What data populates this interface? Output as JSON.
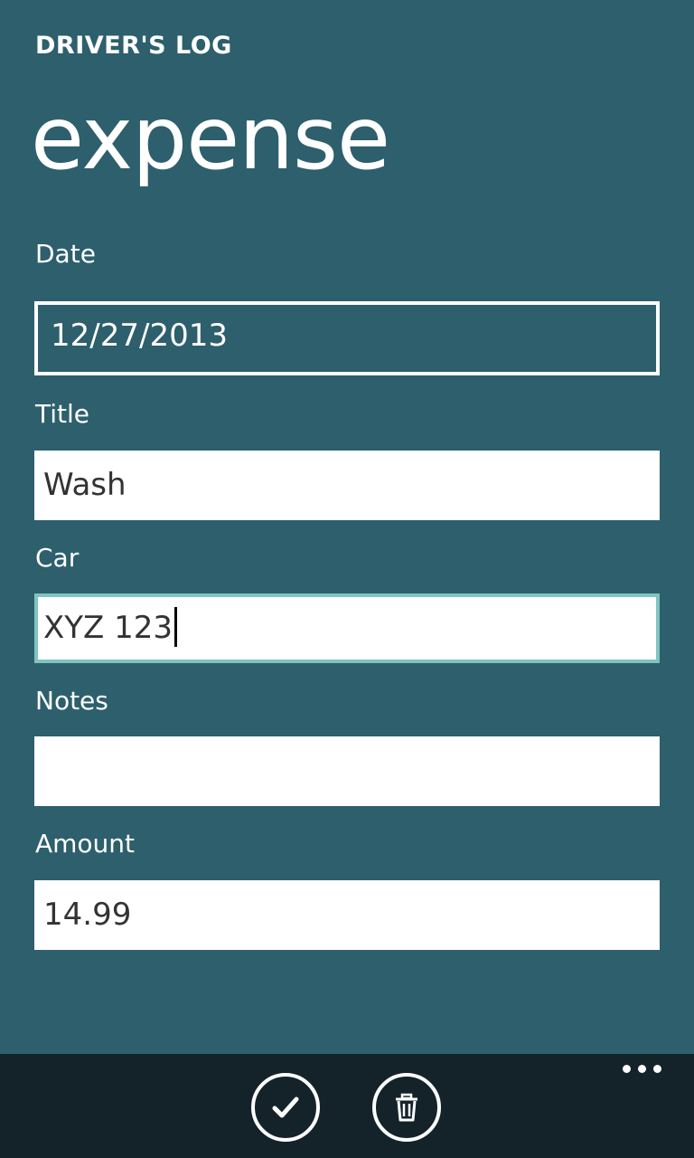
{
  "header": {
    "app_title": "DRIVER'S LOG",
    "page_title": "expense"
  },
  "form": {
    "date": {
      "label": "Date",
      "value": "12/27/2013"
    },
    "title": {
      "label": "Title",
      "value": "Wash"
    },
    "car": {
      "label": "Car",
      "value": "XYZ 123"
    },
    "notes": {
      "label": "Notes",
      "value": ""
    },
    "amount": {
      "label": "Amount",
      "value": "14.99"
    }
  },
  "appbar": {
    "buttons": [
      {
        "name": "save",
        "icon": "check-icon"
      },
      {
        "name": "delete",
        "icon": "trash-icon"
      }
    ],
    "more_icon": "ellipsis-icon"
  },
  "colors": {
    "background": "#2d5f6d",
    "appbar_background": "#14232a",
    "focus_border": "#7fc4c0",
    "field_background": "#ffffff",
    "field_text": "#333333"
  }
}
